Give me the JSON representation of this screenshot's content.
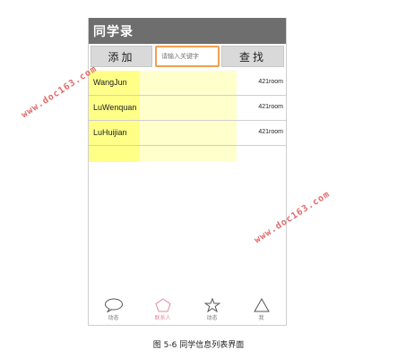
{
  "app": {
    "title": "同学录"
  },
  "toolbar": {
    "add_label": "添加",
    "search_placeholder": "请输入关键字",
    "find_label": "查找"
  },
  "contacts": [
    {
      "name": "WangJun",
      "room": "421room"
    },
    {
      "name": "LuWenquan",
      "room": "421room"
    },
    {
      "name": "LuHuijian",
      "room": "421room"
    }
  ],
  "tabs": [
    {
      "label": "动态",
      "icon": "speech-bubble-icon",
      "active": false
    },
    {
      "label": "联系人",
      "icon": "pentagon-icon",
      "active": true
    },
    {
      "label": "动态",
      "icon": "star-icon",
      "active": false
    },
    {
      "label": "我",
      "icon": "triangle-icon",
      "active": false
    }
  ],
  "watermarks": [
    "www.doc163.com",
    "www.doc163.com"
  ],
  "caption": "图 5-6 同学信息列表界面",
  "colors": {
    "titlebar": "#6e6e6e",
    "search_border": "#f0a050",
    "highlight": "#ffff88",
    "active_tab": "#e08aa0"
  }
}
